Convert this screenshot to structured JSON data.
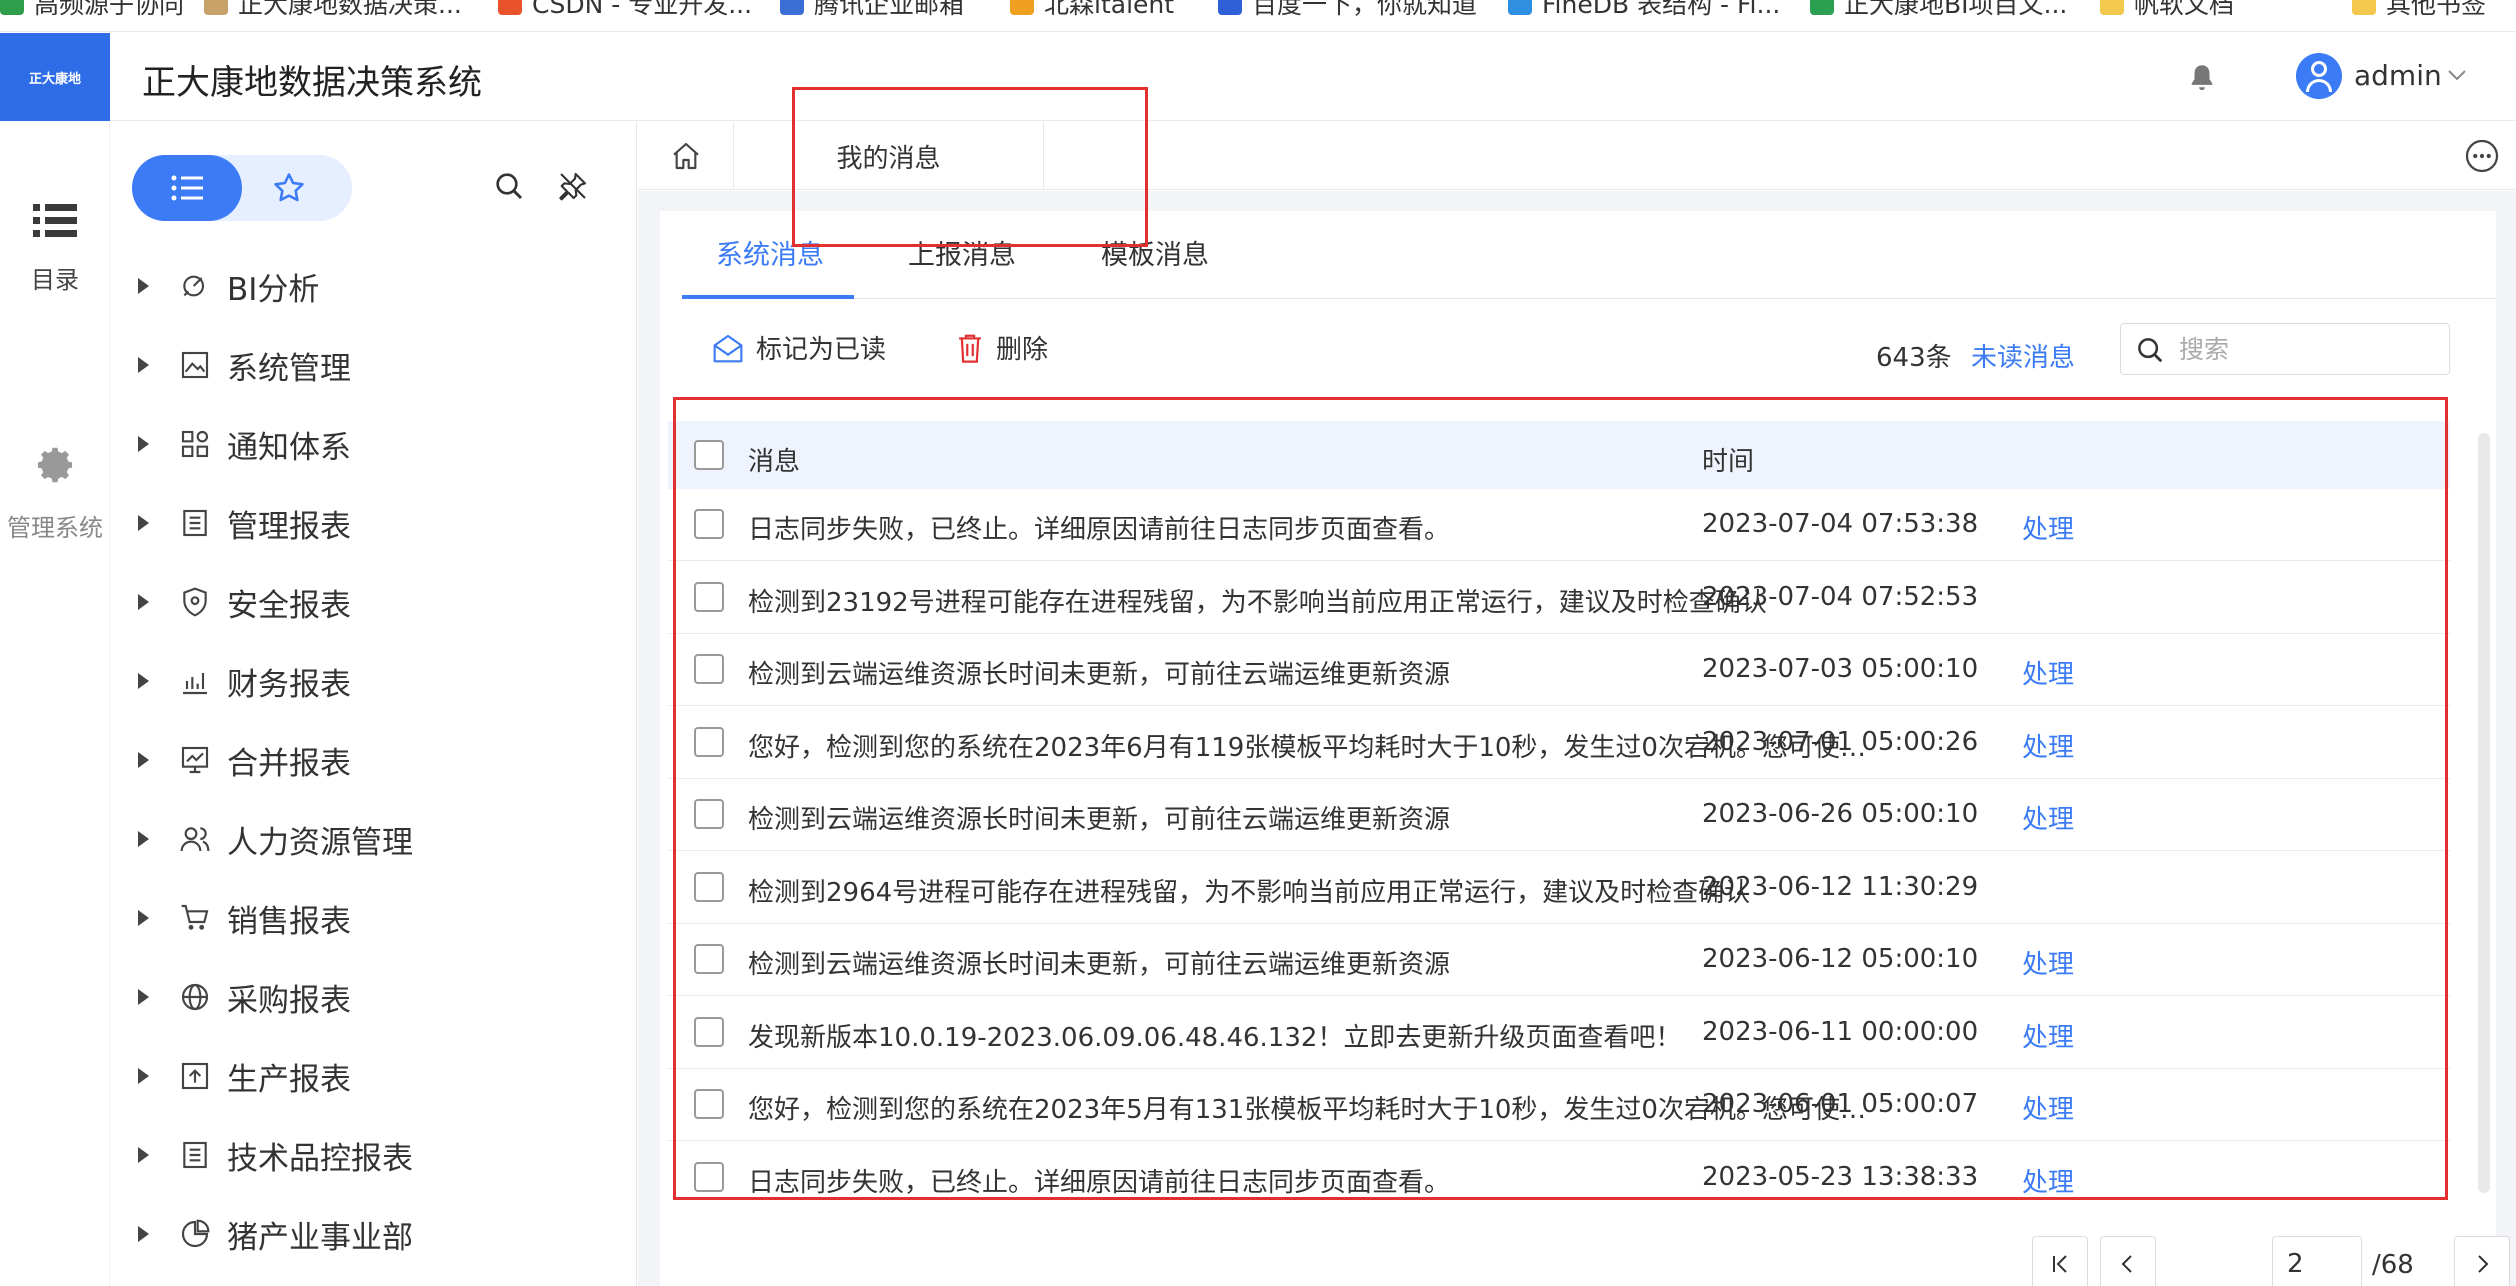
{
  "bookmarks": [
    {
      "label": "高频源子协同",
      "icon_color": "#2e9e4a"
    },
    {
      "label": "正大康地数据决策...",
      "icon_color": "#c9a26a"
    },
    {
      "label": "CSDN - 专业开发...",
      "icon_color": "#e8532c"
    },
    {
      "label": "腾讯企业邮箱",
      "icon_color": "#3b6fd6"
    },
    {
      "label": "北森italent",
      "icon_color": "#f0a020"
    },
    {
      "label": "百度一下，你就知道",
      "icon_color": "#2f5fd6"
    },
    {
      "label": "FineDB 表结构 - Fi...",
      "icon_color": "#2f8fe0"
    },
    {
      "label": "正大康地BI项目文...",
      "icon_color": "#2aa050"
    },
    {
      "label": "帆软文档",
      "icon_color": "#f2c94c"
    },
    {
      "label": "其他书签",
      "icon_color": "#f2c94c"
    }
  ],
  "header": {
    "logo_text": "正大康地",
    "title": "正大康地数据决策系统",
    "username": "admin"
  },
  "rail": {
    "items": [
      {
        "label": "目录",
        "icon": "list-icon"
      },
      {
        "label": "管理系统",
        "icon": "gear-icon"
      }
    ]
  },
  "tree": {
    "items": [
      {
        "label": "BI分析",
        "icon": "bi-analysis-icon"
      },
      {
        "label": "系统管理",
        "icon": "image-icon"
      },
      {
        "label": "通知体系",
        "icon": "grid-icon"
      },
      {
        "label": "管理报表",
        "icon": "report-icon"
      },
      {
        "label": "安全报表",
        "icon": "shield-icon"
      },
      {
        "label": "财务报表",
        "icon": "bar-chart-icon"
      },
      {
        "label": "合并报表",
        "icon": "chart-board-icon"
      },
      {
        "label": "人力资源管理",
        "icon": "people-icon"
      },
      {
        "label": "销售报表",
        "icon": "cart-icon"
      },
      {
        "label": "采购报表",
        "icon": "globe-icon"
      },
      {
        "label": "生产报表",
        "icon": "upload-icon"
      },
      {
        "label": "技术品控报表",
        "icon": "report-icon"
      },
      {
        "label": "猪产业事业部",
        "icon": "pie-icon"
      }
    ]
  },
  "tabbar": {
    "active_tab": "我的消息"
  },
  "subtabs": [
    "系统消息",
    "上报消息",
    "模板消息"
  ],
  "toolbar": {
    "mark_read": "标记为已读",
    "delete": "删除",
    "count": "643条",
    "unread": "未读消息",
    "search_placeholder": "搜索"
  },
  "table": {
    "col_message": "消息",
    "col_time": "时间",
    "rows": [
      {
        "message": "日志同步失败，已终止。详细原因请前往日志同步页面查看。",
        "time": "2023-07-04 07:53:38",
        "action": "处理"
      },
      {
        "message": "检测到23192号进程可能存在进程残留，为不影响当前应用正常运行，建议及时检查确认",
        "time": "2023-07-04 07:52:53",
        "action": ""
      },
      {
        "message": "检测到云端运维资源长时间未更新，可前往云端运维更新资源",
        "time": "2023-07-03 05:00:10",
        "action": "处理"
      },
      {
        "message": "您好，检测到您的系统在2023年6月有119张模板平均耗时大于10秒，发生过0次宕机。您可使用...",
        "time": "2023-07-01 05:00:26",
        "action": "处理"
      },
      {
        "message": "检测到云端运维资源长时间未更新，可前往云端运维更新资源",
        "time": "2023-06-26 05:00:10",
        "action": "处理"
      },
      {
        "message": "检测到2964号进程可能存在进程残留，为不影响当前应用正常运行，建议及时检查确认",
        "time": "2023-06-12 11:30:29",
        "action": ""
      },
      {
        "message": "检测到云端运维资源长时间未更新，可前往云端运维更新资源",
        "time": "2023-06-12 05:00:10",
        "action": "处理"
      },
      {
        "message": "发现新版本10.0.19-2023.06.09.06.48.46.132！立即去更新升级页面查看吧！",
        "time": "2023-06-11 00:00:00",
        "action": "处理"
      },
      {
        "message": "您好，检测到您的系统在2023年5月有131张模板平均耗时大于10秒，发生过0次宕机。您可使用...",
        "time": "2023-06-01 05:00:07",
        "action": "处理"
      },
      {
        "message": "日志同步失败，已终止。详细原因请前往日志同步页面查看。",
        "time": "2023-05-23 13:38:33",
        "action": "处理"
      }
    ]
  },
  "pager": {
    "current": "2",
    "total": "/68"
  },
  "colors": {
    "primary": "#3b7bf6",
    "annotation": "#e23030",
    "header_row": "#eef3fd"
  }
}
